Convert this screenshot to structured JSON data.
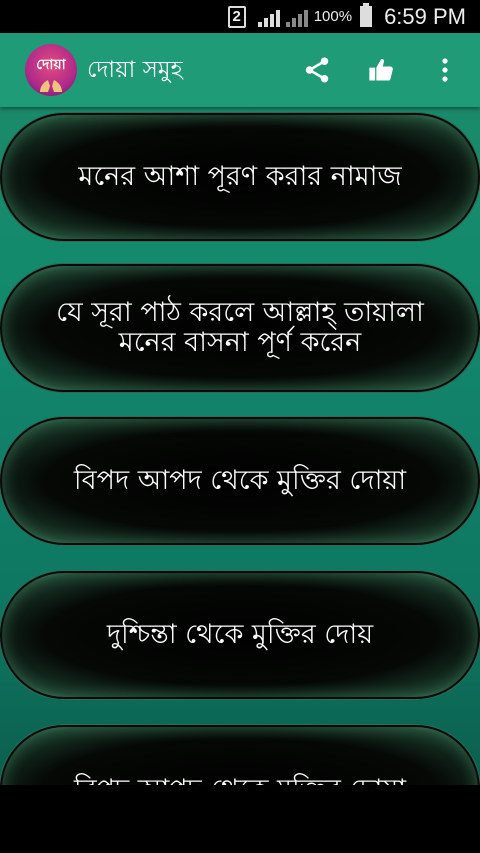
{
  "status_bar": {
    "sim_slot": "2",
    "battery_percent": "100%",
    "time": "6:59 PM"
  },
  "app_bar": {
    "logo_text": "দোয়া",
    "title": "দোয়া সমুহ",
    "icons": [
      "share-icon",
      "thumbs-up-icon",
      "more-vert-icon"
    ]
  },
  "list": {
    "items": [
      {
        "label": "মনের আশা পূরণ করার নামাজ"
      },
      {
        "label": "যে সূরা পাঠ করলে আল্লাহ্ তায়ালা মনের বাসনা পূর্ণ করেন"
      },
      {
        "label": "বিপদ আপদ থেকে মুক্তির দোয়া"
      },
      {
        "label": "দুশ্চিন্তা থেকে মুক্তির দোয়"
      },
      {
        "label": "বিপদ আপদ থেকে মুক্তির দোয়া"
      }
    ]
  },
  "colors": {
    "app_bar": "#1f9b77",
    "list_bg": "#138a6c",
    "pill_bg": "#000000",
    "text": "#ffffff"
  }
}
